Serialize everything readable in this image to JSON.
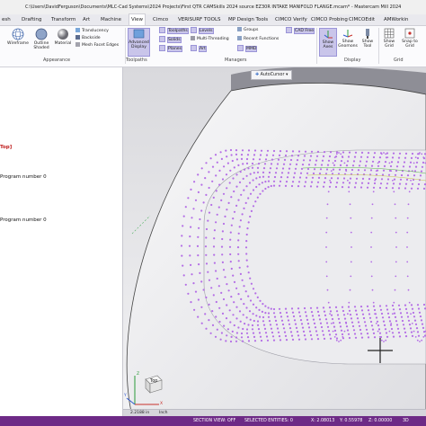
{
  "titlebar": {
    "path": "C:\\Users\\DavidFerguson\\Documents\\MLC-Cad Systems\\2024 Projects\\First QTR CAMSkills 2024 source EZ30R INTAKE MANIFOLD FLANGE.mcam* - Mastercam Mill 2024"
  },
  "tabs": [
    "esh",
    "Drafting",
    "Transform",
    "Art",
    "Machine",
    "View",
    "Cimco",
    "VERISURF TOOLS",
    "MP Design Tools",
    "CIMCO Verify",
    "CIMCO Probing",
    "CIMCOEdit",
    "AMWorkin"
  ],
  "ribbon": {
    "wireframe": "Wireframe",
    "outline_shaded": "Outline Shaded",
    "material": "Material",
    "translucency": "Translucency",
    "backside": "Backside",
    "mesh_facet_edges": "Mesh Facet Edges",
    "advanced_display": "Advanced Display",
    "toolpaths": "Toolpaths",
    "levels": "Levels",
    "solids": "Solids",
    "multi_threading": "Multi-Threading",
    "planes": "Planes",
    "art": "Art",
    "groups": "Groups",
    "recent_functions": "Recent Functions",
    "mmd": "MMD",
    "cad_free": "CAD Free",
    "show_axes": "Show Axes",
    "show_gnomons": "Show Gnomons",
    "show_tool": "Show Tool",
    "show_grid": "Show Grid",
    "snap_to_grid": "Snap to Grid",
    "group_appearance": "Appearance",
    "group_toolpaths": "Toolpaths",
    "group_managers": "Managers",
    "group_display": "Display",
    "group_grid": "Grid"
  },
  "leftpanel": {
    "top_label": "Top]",
    "program1": "Program number 0",
    "program2": "Program number 0"
  },
  "viewport": {
    "autocursor": "AutoCursor",
    "view_label": "Top",
    "axis_z": "Z",
    "axis_x": "X",
    "axis_y": "Y"
  },
  "bottomstrip": {
    "scale": "2.2188 in",
    "unit": "Inch"
  },
  "statusbar": {
    "section_view": "SECTION VIEW: OFF",
    "selected": "SELECTED ENTITIES: 0",
    "x": "X: 2.08013",
    "y": "Y: 0.55978",
    "z": "Z: 0.00000",
    "mode": "3D"
  },
  "colors": {
    "toolpath": "#b46ee6",
    "status_purple": "#6d2a86",
    "highlight": "#c9c5ea"
  }
}
